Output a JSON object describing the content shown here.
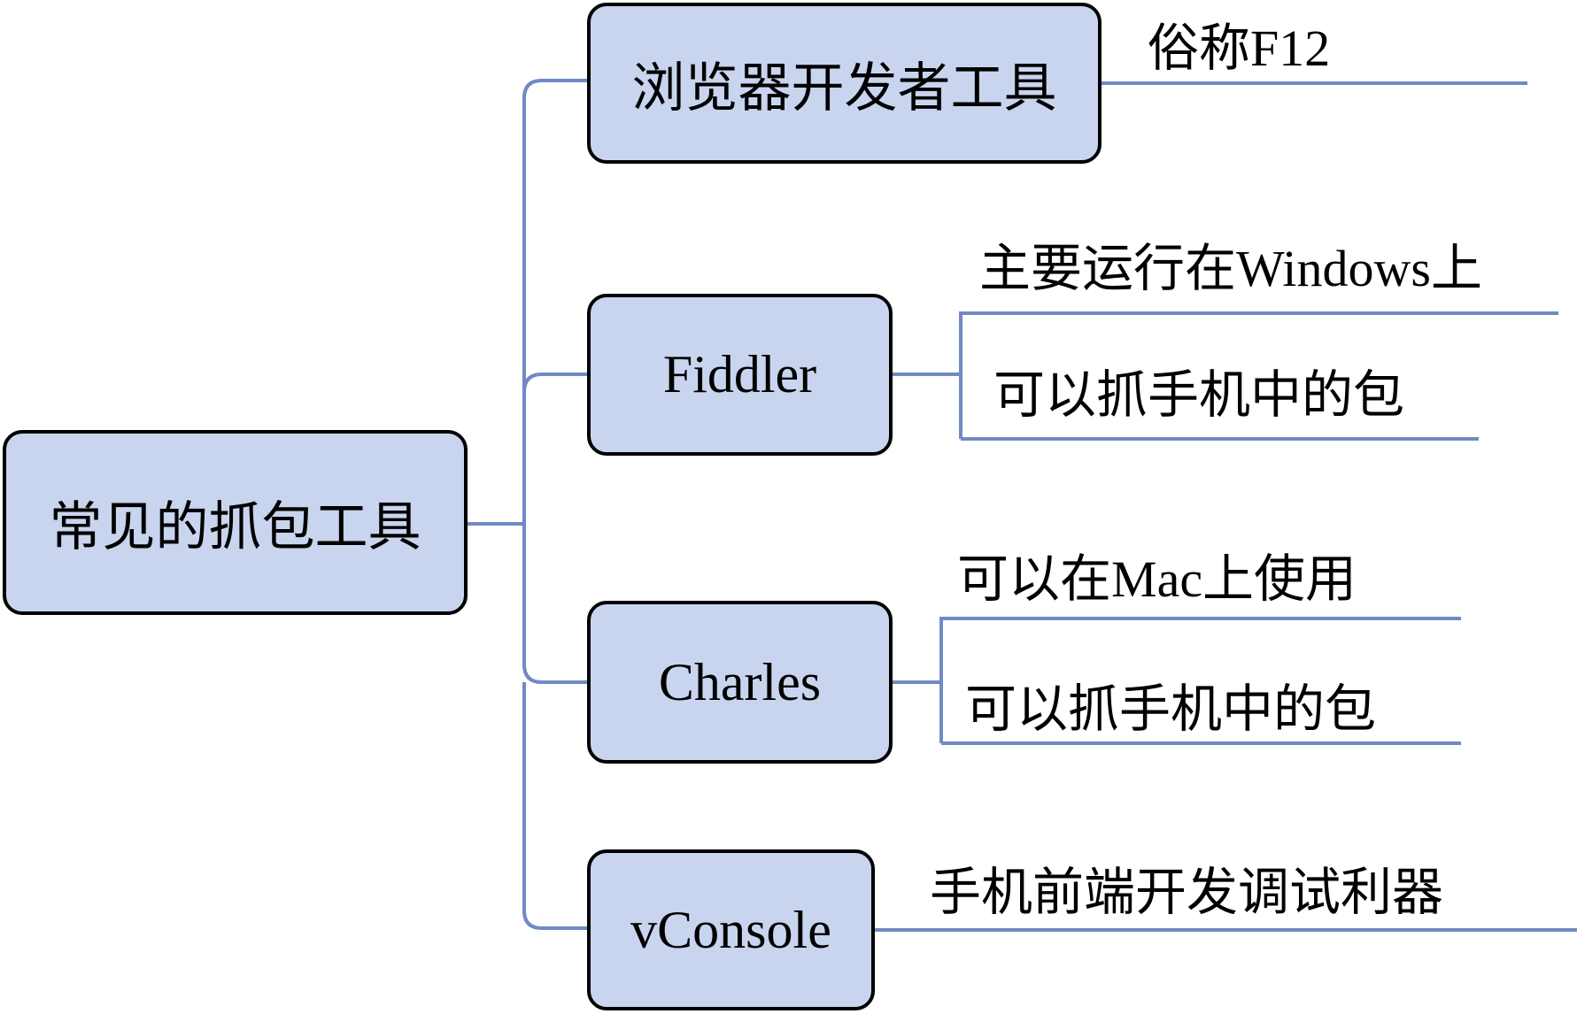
{
  "diagram": {
    "type": "mind-map",
    "line_color": "#7189c4",
    "node_fill": "#c9d5ee",
    "node_border": "#000000",
    "root": {
      "label": "常见的抓包工具"
    },
    "branches": [
      {
        "label": "浏览器开发者工具",
        "notes": [
          "俗称F12"
        ]
      },
      {
        "label": "Fiddler",
        "notes": [
          "主要运行在Windows上",
          "可以抓手机中的包"
        ]
      },
      {
        "label": "Charles",
        "notes": [
          "可以在Mac上使用",
          "可以抓手机中的包"
        ]
      },
      {
        "label": "vConsole",
        "notes": [
          "手机前端开发调试利器"
        ]
      }
    ]
  }
}
